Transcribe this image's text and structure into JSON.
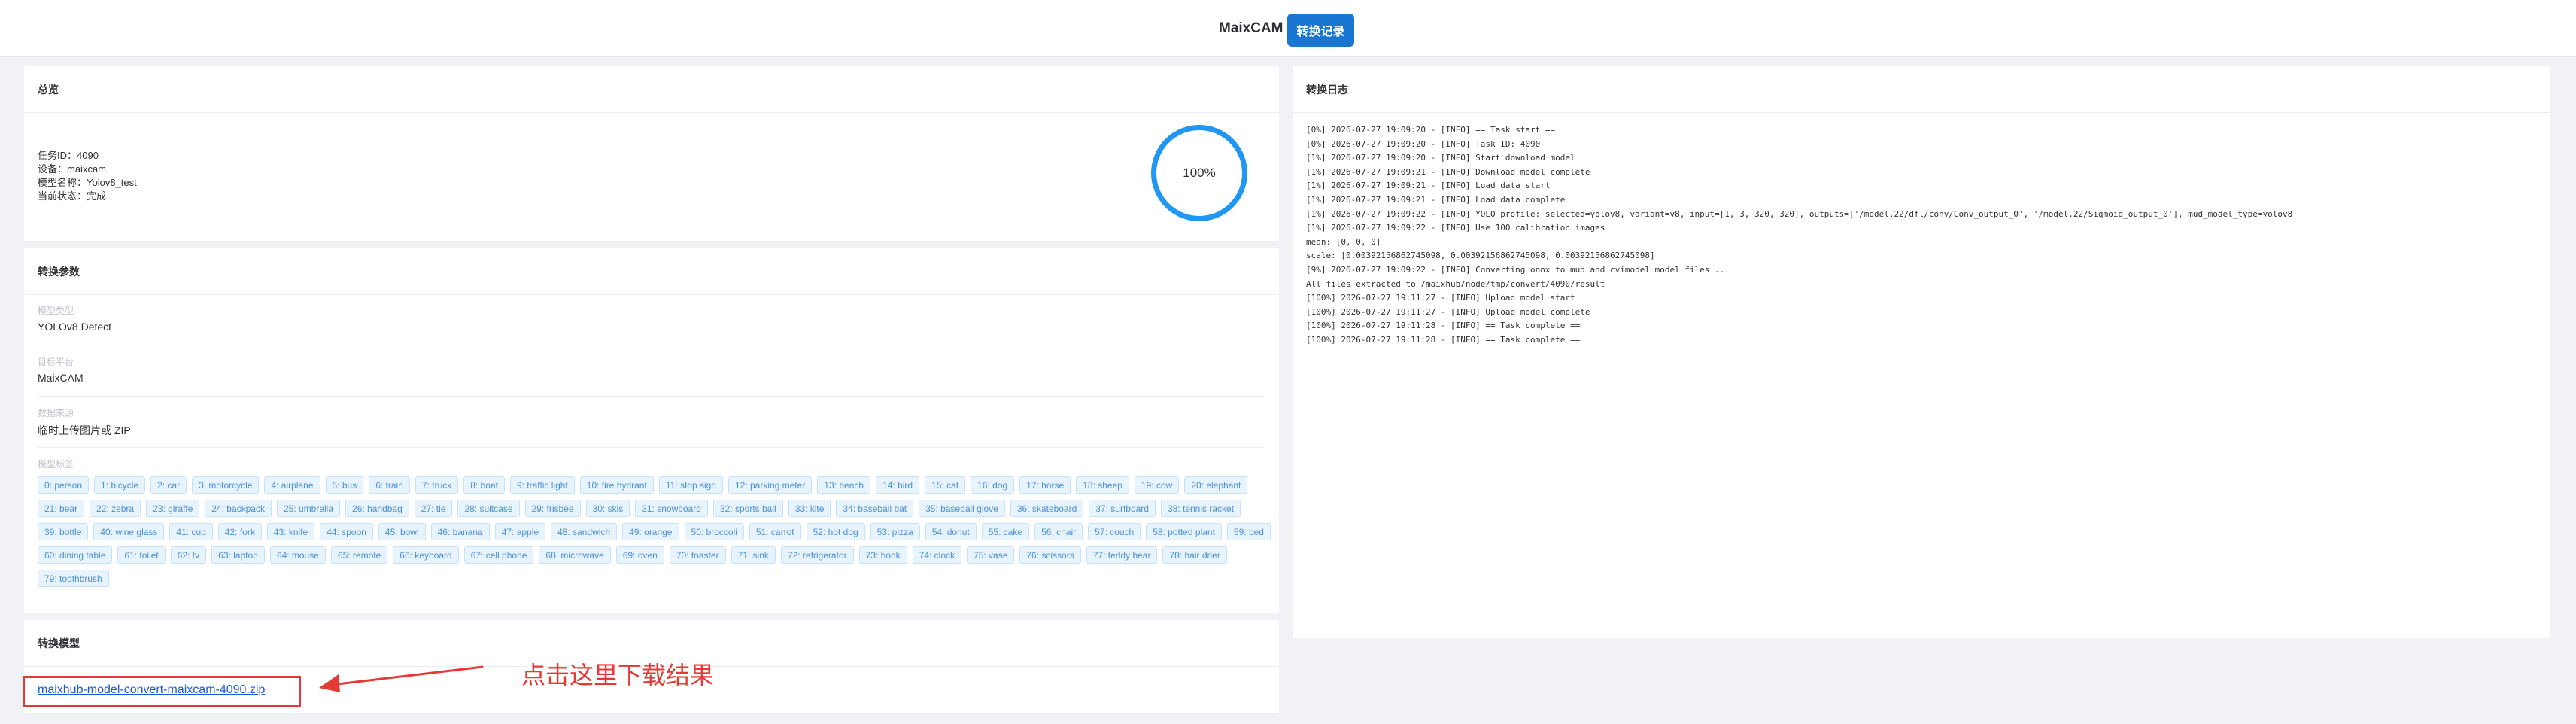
{
  "header": {
    "brand": "MaixCAM",
    "record_button": "转换记录"
  },
  "summary": {
    "title": "总览",
    "lines": [
      "任务ID：4090",
      "设备：maixcam",
      "模型名称：Yolov8_test",
      "当前状态：完成"
    ],
    "progress_text": "100%",
    "progress_value": 100
  },
  "params": {
    "title": "转换参数",
    "items": [
      {
        "label": "模型类型",
        "value": "YOLOv8 Detect"
      },
      {
        "label": "目标平台",
        "value": "MaixCAM"
      },
      {
        "label": "数据来源",
        "value": "临时上传图片或 ZIP"
      }
    ],
    "labels_title": "模型标签",
    "labels": [
      "0: person",
      "1: bicycle",
      "2: car",
      "3: motorcycle",
      "4: airplane",
      "5: bus",
      "6: train",
      "7: truck",
      "8: boat",
      "9: traffic light",
      "10: fire hydrant",
      "11: stop sign",
      "12: parking meter",
      "13: bench",
      "14: bird",
      "15: cat",
      "16: dog",
      "17: horse",
      "18: sheep",
      "19: cow",
      "20: elephant",
      "21: bear",
      "22: zebra",
      "23: giraffe",
      "24: backpack",
      "25: umbrella",
      "26: handbag",
      "27: tie",
      "28: suitcase",
      "29: frisbee",
      "30: skis",
      "31: snowboard",
      "32: sports ball",
      "33: kite",
      "34: baseball bat",
      "35: baseball glove",
      "36: skateboard",
      "37: surfboard",
      "38: tennis racket",
      "39: bottle",
      "40: wine glass",
      "41: cup",
      "42: fork",
      "43: knife",
      "44: spoon",
      "45: bowl",
      "46: banana",
      "47: apple",
      "48: sandwich",
      "49: orange",
      "50: broccoli",
      "51: carrot",
      "52: hot dog",
      "53: pizza",
      "54: donut",
      "55: cake",
      "56: chair",
      "57: couch",
      "58: potted plant",
      "59: bed",
      "60: dining table",
      "61: toilet",
      "62: tv",
      "63: laptop",
      "64: mouse",
      "65: remote",
      "66: keyboard",
      "67: cell phone",
      "68: microwave",
      "69: oven",
      "70: toaster",
      "71: sink",
      "72: refrigerator",
      "73: book",
      "74: clock",
      "75: vase",
      "76: scissors",
      "77: teddy bear",
      "78: hair drier",
      "79: toothbrush"
    ]
  },
  "model": {
    "title": "转换模型",
    "link_text": "maixhub-model-convert-maixcam-4090.zip",
    "annotation": "点击这里下载结果"
  },
  "log": {
    "title": "转换日志",
    "lines": [
      "[0%] 2026-07-27 19:09:20 - [INFO] == Task start ==",
      "[0%] 2026-07-27 19:09:20 - [INFO] Task ID: 4090",
      "[1%] 2026-07-27 19:09:20 - [INFO] Start download model",
      "[1%] 2026-07-27 19:09:21 - [INFO] Download model complete",
      "[1%] 2026-07-27 19:09:21 - [INFO] Load data start",
      "[1%] 2026-07-27 19:09:21 - [INFO] Load data complete",
      "[1%] 2026-07-27 19:09:22 - [INFO] YOLO profile: selected=yolov8, variant=v8, input=[1, 3, 320, 320], outputs=['/model.22/dfl/conv/Conv_output_0', '/model.22/Sigmoid_output_0'], mud_model_type=yolov8",
      "[1%] 2026-07-27 19:09:22 - [INFO] Use 100 calibration images",
      "mean: [0, 0, 0]",
      "scale: [0.00392156862745098, 0.00392156862745098, 0.00392156862745098]",
      "[9%] 2026-07-27 19:09:22 - [INFO] Converting onnx to mud and cvimodel model files ...",
      "All files extracted to /maixhub/node/tmp/convert/4090/result",
      "[100%] 2026-07-27 19:11:27 - [INFO] Upload model start",
      "[100%] 2026-07-27 19:11:27 - [INFO] Upload model complete",
      "[100%] 2026-07-27 19:11:28 - [INFO] == Task complete ==",
      "[100%] 2026-07-27 19:11:28 - [INFO] == Task complete =="
    ]
  },
  "colors": {
    "primary": "#1976d2",
    "ring": "#2196f3",
    "chip_bg": "#e8f4fd",
    "chip_text": "#4a90d9",
    "annotation": "#e53935"
  }
}
